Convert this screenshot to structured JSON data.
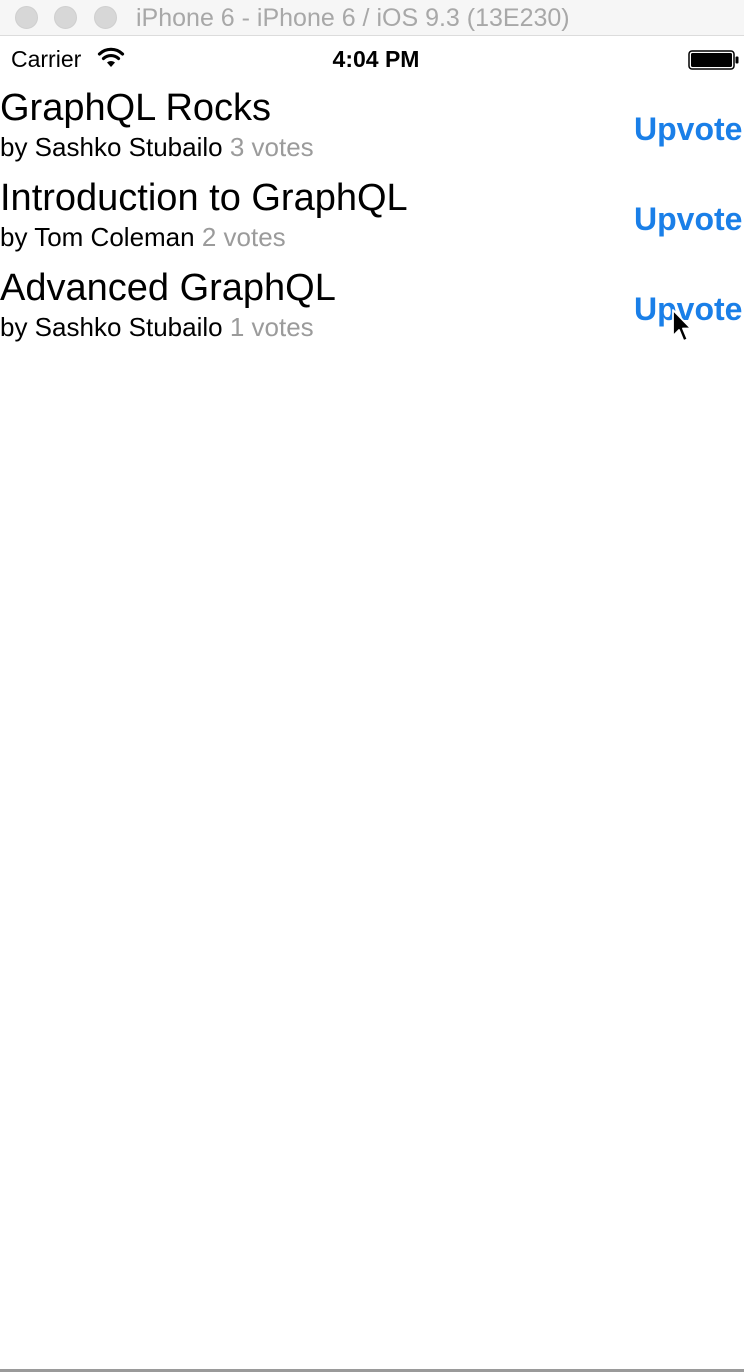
{
  "window": {
    "title": "iPhone 6 - iPhone 6 / iOS 9.3 (13E230)"
  },
  "status_bar": {
    "carrier": "Carrier",
    "time": "4:04 PM",
    "icons": [
      "wifi-icon",
      "battery-icon"
    ]
  },
  "posts": [
    {
      "title": "GraphQL Rocks",
      "author_line": "by Sashko Stubailo",
      "votes": "3 votes",
      "action": "Upvote"
    },
    {
      "title": "Introduction to GraphQL",
      "author_line": "by Tom Coleman",
      "votes": "2 votes",
      "action": "Upvote"
    },
    {
      "title": "Advanced GraphQL",
      "author_line": "by Sashko Stubailo",
      "votes": "1 votes",
      "action": "Upvote"
    }
  ],
  "colors": {
    "accent": "#1a7fe8",
    "muted_text": "#9b9b9b"
  }
}
